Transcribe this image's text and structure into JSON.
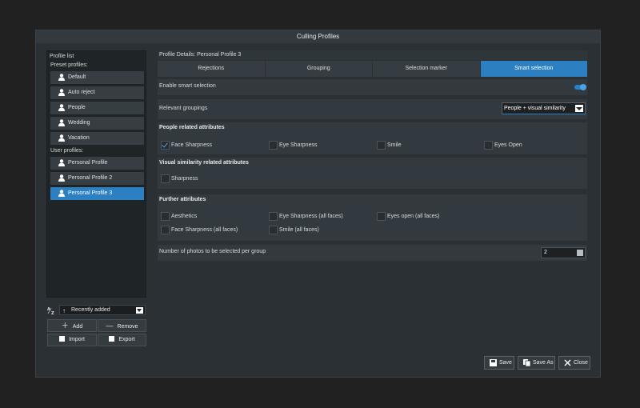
{
  "window": {
    "title": "Culling Profiles"
  },
  "profile_list": {
    "header": "Profile list",
    "preset_label": "Preset profiles:",
    "presets": [
      "Default",
      "Auto reject",
      "People",
      "Wedding",
      "Vacation"
    ],
    "user_label": "User profiles:",
    "users": [
      "Personal Profile",
      "Personal Profile 2",
      "Personal Profile 3"
    ],
    "selected": "Personal Profile 3",
    "sort_value": "Recently added",
    "sort_icon": "sort-az-icon",
    "buttons": {
      "add": "Add",
      "remove": "Remove",
      "import": "Import",
      "export": "Export"
    }
  },
  "details": {
    "header": "Profile Details: Personal Profile 3",
    "tabs": [
      "Rejections",
      "Grouping",
      "Selection marker",
      "Smart selection"
    ],
    "active_tab": "Smart selection",
    "enable_label": "Enable smart selection",
    "enable_on": true,
    "relevant_label": "Relevant groupings",
    "relevant_value": "People + visual similarity",
    "people_title": "People related attributes",
    "people_attrs": [
      {
        "label": "Face Sharpness",
        "checked": true
      },
      {
        "label": "Eye Sharpness",
        "checked": false
      },
      {
        "label": "Smile",
        "checked": false
      },
      {
        "label": "Eyes Open",
        "checked": false
      }
    ],
    "visual_title": "Visual similarity related attributes",
    "visual_attrs": [
      {
        "label": "Sharpness",
        "checked": false
      }
    ],
    "further_title": "Further attributes",
    "further_attrs": [
      {
        "label": "Aesthetics",
        "checked": false
      },
      {
        "label": "Eye Sharpness (all faces)",
        "checked": false
      },
      {
        "label": "Eyes open (all faces)",
        "checked": false
      },
      {
        "label": "Face Sharpness (all faces)",
        "checked": false
      },
      {
        "label": "Smile (all faces)",
        "checked": false
      }
    ],
    "photos_label": "Number of photos to be selected per group",
    "photos_value": "2"
  },
  "footer": {
    "save": "Save",
    "save_as": "Save As",
    "close": "Close"
  },
  "colors": {
    "accent": "#2c7fc0",
    "background": "#2a3034"
  }
}
